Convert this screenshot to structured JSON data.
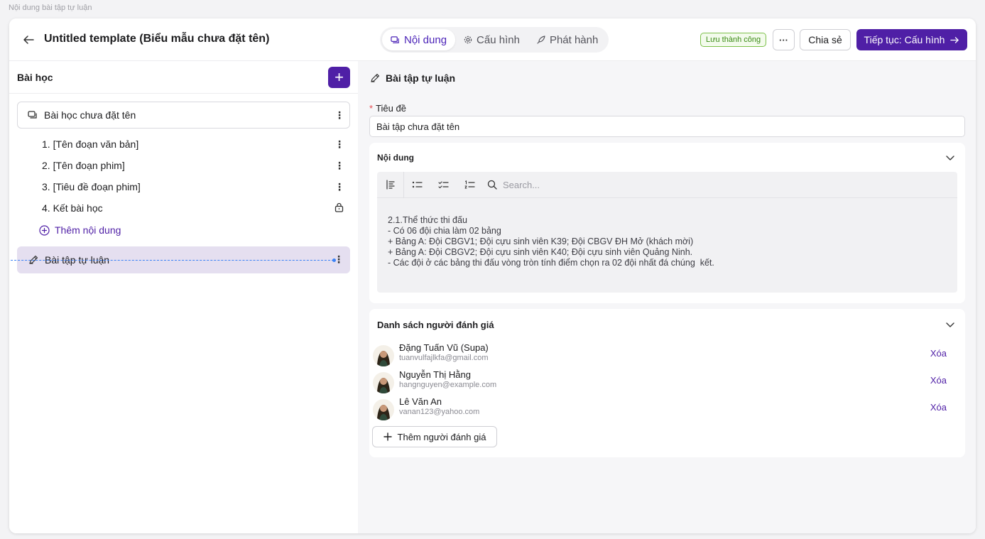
{
  "page_label": "Nội dung bài tập tự luận",
  "header": {
    "title": "Untitled template (Biểu mẫu chưa đặt tên)",
    "tabs": [
      {
        "label": "Nội dung",
        "icon": "content-icon",
        "active": true
      },
      {
        "label": "Cấu hình",
        "icon": "gear-icon",
        "active": false
      },
      {
        "label": "Phát hành",
        "icon": "rocket-icon",
        "active": false
      }
    ],
    "status_badge": "Lưu thành công",
    "more_label": "···",
    "share_label": "Chia sẻ",
    "continue_label": "Tiếp tục: Cấu hình"
  },
  "sidebar": {
    "title": "Bài học",
    "add_label": "+",
    "lesson": "Bài học chưa đặt tên",
    "items": [
      "1. [Tên đoạn văn bản]",
      "2. [Tên đoạn phim]",
      "3. [Tiêu đề đoạn phim]",
      "4. Kết bài học"
    ],
    "add_content": "Thêm nội dung",
    "essay": "Bài tập tự luận"
  },
  "main": {
    "title": "Bài tập tự luận",
    "field_label": "Tiêu đề",
    "required_mark": "*",
    "title_value": "Bài tập chưa đặt tên",
    "content_card": {
      "title": "Nội dung",
      "search_placeholder": "Search...",
      "body": "2.1.Thể thức thi đấu\n- Có 06 đội chia làm 02 bảng\n+ Bảng A: Đội CBGV1; Đội cựu sinh viên K39; Đội CBGV ĐH Mở (khách mời)\n+ Bảng A: Đội CBGV2; Đội cựu sinh viên K40; Đội cựu sinh viên Quảng Ninh.\n- Các đội ở các bảng thi đấu vòng tròn tính điểm chọn ra 02 đội nhất đá chúng  kết."
    },
    "reviewers_card": {
      "title": "Danh sách người đánh giá",
      "reviewers": [
        {
          "name": "Đặng Tuấn Vũ (Supa)",
          "email": "tuanvulfajlkfa@gmail.com",
          "action": "Xóa"
        },
        {
          "name": "Nguyễn Thị Hằng",
          "email": "hangnguyen@example.com",
          "action": "Xóa"
        },
        {
          "name": "Lê Văn An",
          "email": "vanan123@yahoo.com",
          "action": "Xóa"
        }
      ],
      "add_label": "Thêm người đánh giá"
    }
  },
  "colors": {
    "accent": "#4f1fa6",
    "selected_bg": "#e5dff0",
    "success": "#3a8a14"
  }
}
